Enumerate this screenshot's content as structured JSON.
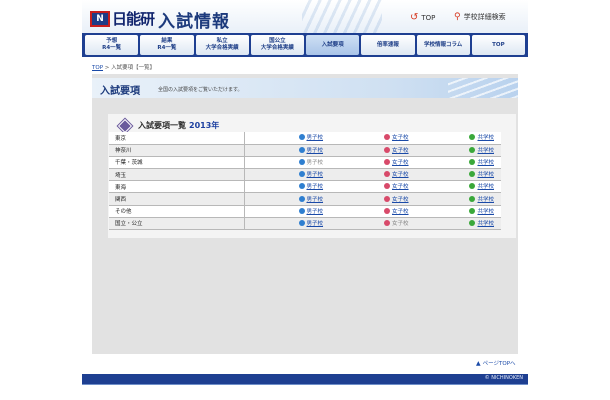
{
  "header": {
    "logo_mark": "N",
    "logo_text": "日能研",
    "site_title": "入試情報",
    "top_link": "TOP",
    "search_link": "学校詳細検索",
    "colors": {
      "navy": "#1e3f91",
      "accent_red": "#d7371e"
    }
  },
  "nav": [
    {
      "line1": "予想",
      "line2": "R4一覧",
      "active": false
    },
    {
      "line1": "結果",
      "line2": "R4一覧",
      "active": false
    },
    {
      "line1": "私立",
      "line2": "大学合格実績",
      "active": false
    },
    {
      "line1": "国公立",
      "line2": "大学合格実績",
      "active": false
    },
    {
      "line1": "入試要項",
      "line2": "",
      "active": true
    },
    {
      "line1": "倍率速報",
      "line2": "",
      "active": false
    },
    {
      "line1": "学校情報コラム",
      "line2": "",
      "active": false
    },
    {
      "line1": "TOP",
      "line2": "",
      "active": false
    }
  ],
  "breadcrumb": {
    "root": "TOP",
    "separator": ">",
    "current": "入試要項【一覧】"
  },
  "main": {
    "heading": "入試要項",
    "description": "全国の入試要項をご覧いただけます。",
    "list_title": "入試要項一覧",
    "list_year": "2013年",
    "labels": {
      "boys": "男子校",
      "girls": "女子校",
      "coed": "共学校"
    },
    "rows": [
      {
        "region": "東京",
        "boys": true,
        "girls": true,
        "coed": true
      },
      {
        "region": "神奈川",
        "boys": true,
        "girls": true,
        "coed": true
      },
      {
        "region": "千葉・茨城",
        "boys": false,
        "girls": true,
        "coed": true
      },
      {
        "region": "埼玉",
        "boys": true,
        "girls": true,
        "coed": true
      },
      {
        "region": "東海",
        "boys": true,
        "girls": true,
        "coed": true
      },
      {
        "region": "関西",
        "boys": true,
        "girls": true,
        "coed": true
      },
      {
        "region": "その他",
        "boys": true,
        "girls": true,
        "coed": true
      },
      {
        "region": "国立・公立",
        "boys": true,
        "girls": false,
        "coed": true
      }
    ]
  },
  "page_top": "ページTOPへ",
  "footer": {
    "copyright": "© NICHINOKEN"
  }
}
